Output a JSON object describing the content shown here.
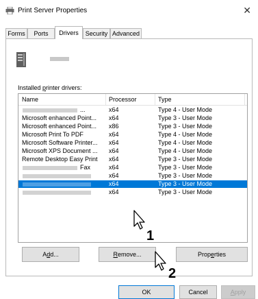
{
  "window": {
    "title": "Print Server Properties",
    "close_glyph": "✕",
    "title_icon": "printer-icon"
  },
  "tabs": [
    {
      "label": "Forms"
    },
    {
      "label": "Ports"
    },
    {
      "label": "Drivers"
    },
    {
      "label": "Security"
    },
    {
      "label": "Advanced"
    }
  ],
  "active_tab": "Drivers",
  "server": {
    "icon": "server-tower-icon"
  },
  "drivers_list": {
    "label_prefix": "Installed ",
    "label_accel": "p",
    "label_suffix": "rinter drivers:",
    "columns": {
      "name": "Name",
      "processor": "Processor",
      "type": "Type"
    },
    "rows": [
      {
        "name": "",
        "name_suffix": "...",
        "processor": "x64",
        "type": "Type 4 - User Mode"
      },
      {
        "name": "Microsoft enhanced Point...",
        "name_suffix": "",
        "processor": "x64",
        "type": "Type 3 - User Mode"
      },
      {
        "name": "Microsoft enhanced Point...",
        "name_suffix": "",
        "processor": "x86",
        "type": "Type 3 - User Mode"
      },
      {
        "name": "Microsoft Print To PDF",
        "name_suffix": "",
        "processor": "x64",
        "type": "Type 4 - User Mode"
      },
      {
        "name": "Microsoft Software Printer...",
        "name_suffix": "",
        "processor": "x64",
        "type": "Type 4 - User Mode"
      },
      {
        "name": "Microsoft XPS Document ...",
        "name_suffix": "",
        "processor": "x64",
        "type": "Type 4 - User Mode"
      },
      {
        "name": "Remote Desktop Easy Print",
        "name_suffix": "",
        "processor": "x64",
        "type": "Type 3 - User Mode"
      },
      {
        "name": "",
        "name_suffix": "Fax",
        "processor": "x64",
        "type": "Type 3 - User Mode"
      },
      {
        "name": "",
        "name_suffix": "",
        "processor": "x64",
        "type": "Type 3 - User Mode"
      },
      {
        "name": "",
        "name_suffix": "",
        "processor": "x64",
        "type": "Type 3 - User Mode",
        "selected": true
      },
      {
        "name": "",
        "name_suffix": "",
        "processor": "x64",
        "type": "Type 3 - User Mode"
      }
    ]
  },
  "buttons": {
    "add": {
      "pre": "A",
      "accel": "d",
      "post": "d..."
    },
    "remove": {
      "pre": "",
      "accel": "R",
      "post": "emove..."
    },
    "properties": {
      "pre": "Prop",
      "accel": "e",
      "post": "rties"
    },
    "ok": "OK",
    "cancel": "Cancel",
    "apply": {
      "pre": "",
      "accel": "A",
      "post": "pply"
    }
  },
  "callouts": {
    "one": "1",
    "two": "2"
  },
  "colors": {
    "selection": "#0078d7",
    "focus_border": "#0078d7"
  }
}
